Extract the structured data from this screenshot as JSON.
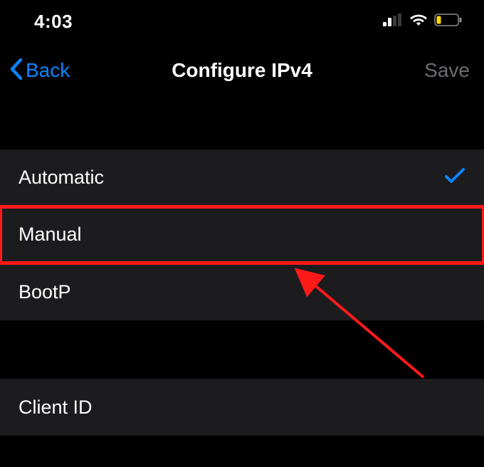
{
  "status": {
    "time": "4:03"
  },
  "nav": {
    "back_label": "Back",
    "title": "Configure IPv4",
    "save_label": "Save"
  },
  "options": [
    {
      "label": "Automatic",
      "selected": true
    },
    {
      "label": "Manual",
      "selected": false
    },
    {
      "label": "BootP",
      "selected": false
    }
  ],
  "fields": [
    {
      "label": "Client ID"
    }
  ],
  "annotation": {
    "highlight_index": 1
  }
}
